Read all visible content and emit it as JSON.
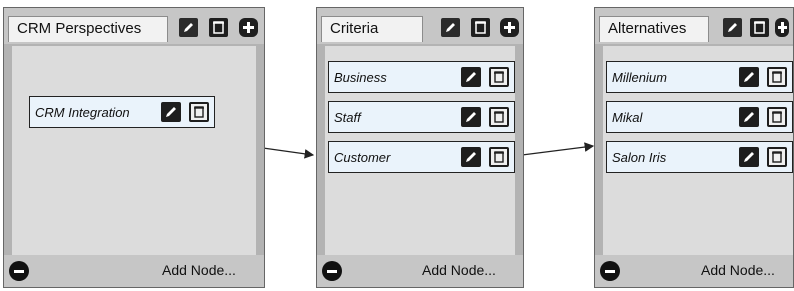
{
  "panels": [
    {
      "title": "CRM Perspectives",
      "add_node": "Add Node...",
      "nodes": [
        {
          "label": "CRM Integration"
        }
      ]
    },
    {
      "title": "Criteria",
      "add_node": "Add Node...",
      "nodes": [
        {
          "label": "Business"
        },
        {
          "label": "Staff"
        },
        {
          "label": "Customer"
        }
      ]
    },
    {
      "title": "Alternatives",
      "add_node": "Add Node...",
      "nodes": [
        {
          "label": "Millenium"
        },
        {
          "label": "Mikal"
        },
        {
          "label": "Salon Iris"
        }
      ]
    }
  ],
  "icons": {
    "edit": "pencil-icon",
    "delete": "trash-icon",
    "add": "plus-icon",
    "remove": "minus-icon",
    "connector": "arrow-right-icon"
  }
}
